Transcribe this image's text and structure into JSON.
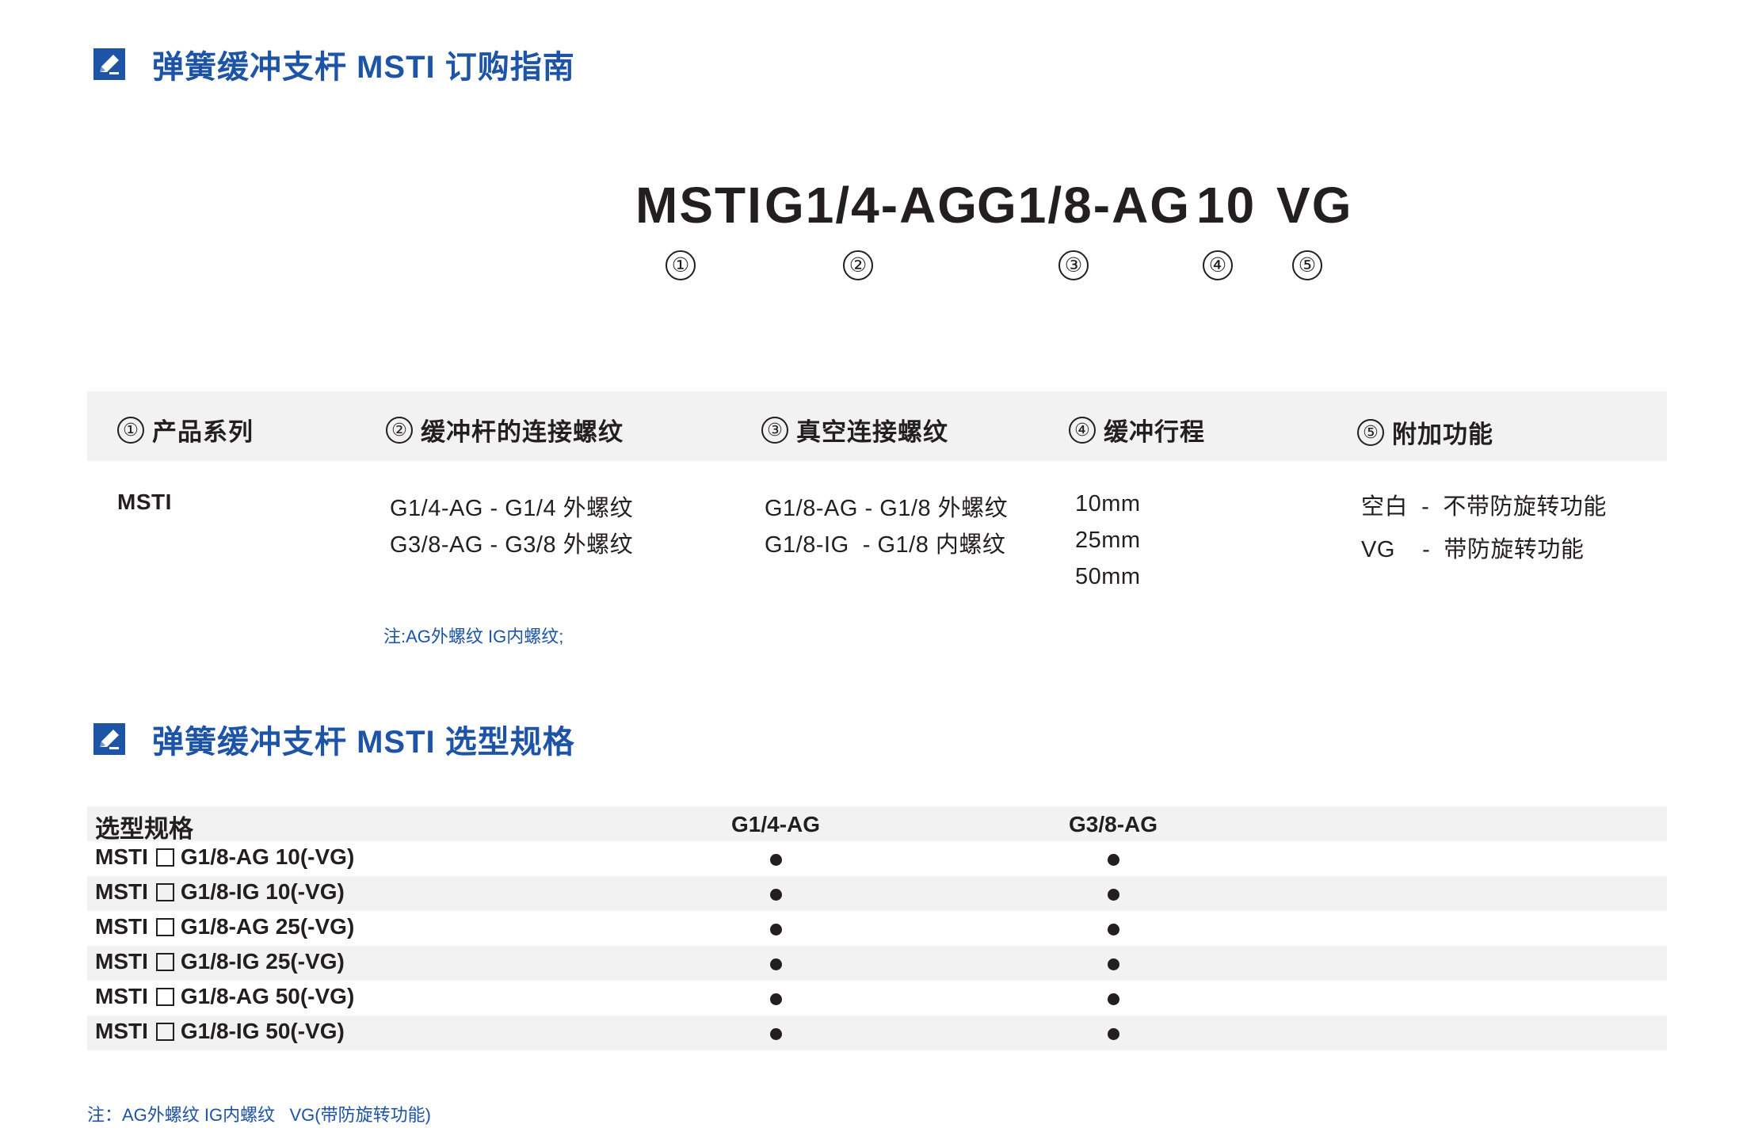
{
  "section1": {
    "title": "弹簧缓冲支杆 MSTI 订购指南"
  },
  "code": {
    "parts": [
      "MSTI",
      "G1/4-AG",
      "G1/8-AG",
      "10",
      "VG"
    ],
    "markers": [
      "①",
      "②",
      "③",
      "④",
      "⑤"
    ]
  },
  "guide": {
    "headers": [
      {
        "num": "①",
        "label": "产品系列"
      },
      {
        "num": "②",
        "label": "缓冲杆的连接螺纹"
      },
      {
        "num": "③",
        "label": "真空连接螺纹"
      },
      {
        "num": "④",
        "label": "缓冲行程"
      },
      {
        "num": "⑤",
        "label": "附加功能"
      }
    ],
    "series": "MSTI",
    "rod_threads": [
      "G1/4-AG - G1/4 外螺纹",
      "G3/8-AG - G3/8 外螺纹"
    ],
    "vacuum_threads": [
      "G1/8-AG - G1/8 外螺纹",
      "G1/8-IG  - G1/8 内螺纹"
    ],
    "strokes": [
      "10mm",
      "25mm",
      "50mm"
    ],
    "options": [
      "空白  -  不带防旋转功能",
      "VG    -  带防旋转功能"
    ],
    "note": "注:AG外螺纹 IG内螺纹;"
  },
  "section2": {
    "title": "弹簧缓冲支杆 MSTI 选型规格"
  },
  "spec": {
    "header_label": "选型规格",
    "columns": [
      "G1/4-AG",
      "G3/8-AG"
    ],
    "rows": [
      {
        "prefix": "MSTI",
        "model": "G1/8-AG 10(-VG)",
        "g14": "●",
        "g38": "●"
      },
      {
        "prefix": "MSTI",
        "model": "G1/8-IG 10(-VG)",
        "g14": "●",
        "g38": "●"
      },
      {
        "prefix": "MSTI",
        "model": "G1/8-AG 25(-VG)",
        "g14": "●",
        "g38": "●"
      },
      {
        "prefix": "MSTI",
        "model": "G1/8-IG 25(-VG)",
        "g14": "●",
        "g38": "●"
      },
      {
        "prefix": "MSTI",
        "model": "G1/8-AG 50(-VG)",
        "g14": "●",
        "g38": "●"
      },
      {
        "prefix": "MSTI",
        "model": "G1/8-IG 50(-VG)",
        "g14": "●",
        "g38": "●"
      }
    ]
  },
  "footer_note": "注：AG外螺纹 IG内螺纹   VG(带防旋转功能)",
  "colors": {
    "accent": "#1d54a6",
    "text": "#231f20",
    "band": "#f2f2f2"
  }
}
